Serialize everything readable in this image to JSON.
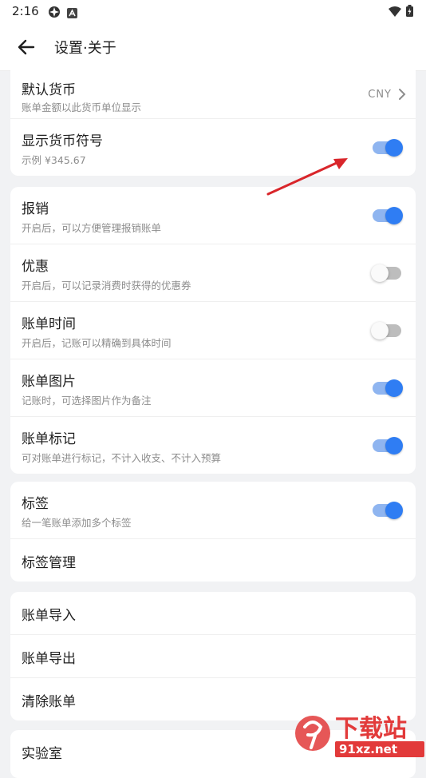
{
  "status_bar": {
    "time": "2:16"
  },
  "header": {
    "title": "设置·关于"
  },
  "currency": {
    "default_currency": {
      "title": "默认货币",
      "subtitle": "账单金额以此货币单位显示",
      "value": "CNY"
    },
    "show_symbol": {
      "title": "显示货币符号",
      "subtitle": "示例 ¥345.67",
      "enabled": true
    }
  },
  "features": [
    {
      "title": "报销",
      "subtitle": "开启后，可以方便管理报销账单",
      "enabled": true
    },
    {
      "title": "优惠",
      "subtitle": "开启后，可以记录消费时获得的优惠券",
      "enabled": false
    },
    {
      "title": "账单时间",
      "subtitle": "开启后，记账可以精确到具体时间",
      "enabled": false
    },
    {
      "title": "账单图片",
      "subtitle": "记账时，可选择图片作为备注",
      "enabled": true
    },
    {
      "title": "账单标记",
      "subtitle": "可对账单进行标记，不计入收支、不计入预算",
      "enabled": true
    }
  ],
  "tags": {
    "tag_toggle": {
      "title": "标签",
      "subtitle": "给一笔账单添加多个标签",
      "enabled": true
    },
    "manage": {
      "title": "标签管理"
    }
  },
  "bill_actions": [
    {
      "title": "账单导入"
    },
    {
      "title": "账单导出"
    },
    {
      "title": "清除账单"
    }
  ],
  "lab": {
    "title": "实验室"
  },
  "watermark": {
    "brand": "下载站",
    "url": "91xz.net"
  },
  "colors": {
    "accent": "#2f7df3",
    "track_on": "#8fb5f0",
    "annotation_arrow": "#d9262b"
  }
}
